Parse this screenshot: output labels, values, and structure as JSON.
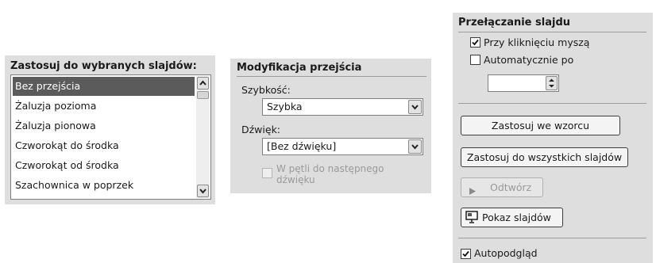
{
  "apply_panel": {
    "title": "Zastosuj do wybranych slajdów:",
    "transitions": [
      "Bez przejścia",
      "Żaluzja pozioma",
      "Żaluzja pionowa",
      "Czworokąt do środka",
      "Czworokąt od środka",
      "Szachownica w poprzek"
    ],
    "selected_index": 0
  },
  "modify_panel": {
    "title": "Modyfikacja przejścia",
    "speed_label": "Szybkość:",
    "speed_value": "Szybka",
    "sound_label": "Dźwięk:",
    "sound_value": "[Bez dźwięku]",
    "loop_label_line1": "W pętli do następnego",
    "loop_label_line2": "dźwięku",
    "loop_checked": false,
    "loop_enabled": false
  },
  "advance_panel": {
    "title": "Przełączanie slajdu",
    "on_click_label": "Przy kliknięciu myszą",
    "on_click_checked": true,
    "auto_label": "Automatycznie po",
    "auto_checked": false,
    "auto_value": "",
    "apply_master_label": "Zastosuj we wzorcu",
    "apply_all_label": "Zastosuj do wszystkich slajdów",
    "play_label": "Odtwórz",
    "slideshow_label": "Pokaz slajdów",
    "autopreview_label": "Autopodgląd",
    "autopreview_checked": true
  },
  "icons": {
    "scroll_up": "chevron-up-icon",
    "scroll_down": "chevron-down-icon",
    "dropdown": "chevron-down-icon",
    "play": "play-icon",
    "slideshow": "projector-screen-icon",
    "check": "check-icon"
  },
  "colors": {
    "panel_bg": "#dedede",
    "selection_bg": "#5b5b5b",
    "disabled_text": "#9a9a9a"
  }
}
